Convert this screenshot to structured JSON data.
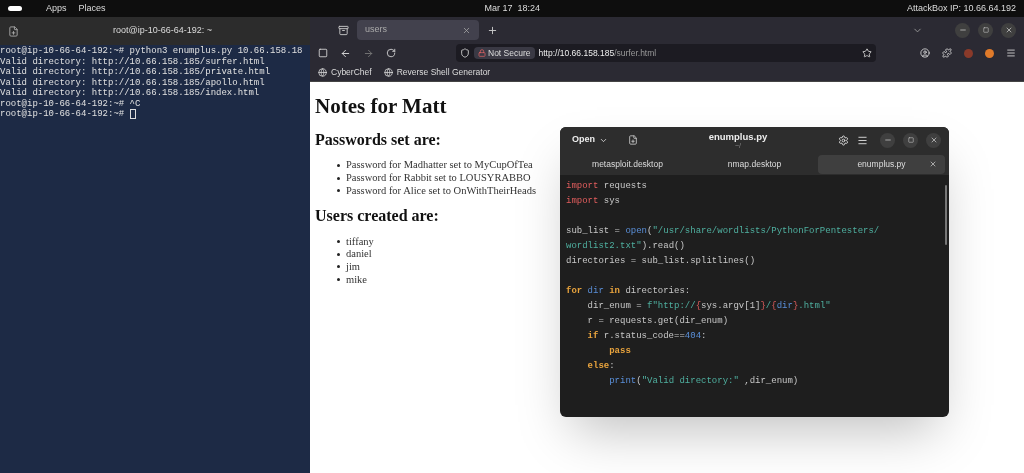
{
  "top_bar": {
    "menus": [
      "Apps",
      "Places"
    ],
    "clock": "Mar 17  18:24",
    "ip_label": "AttackBox IP: 10.66.64.192"
  },
  "terminal": {
    "title": "root@ip-10-66-64-192: ~",
    "lines": [
      "root@ip-10-66-64-192:~# python3 enumplus.py 10.66.158.18",
      "Valid directory: http://10.66.158.185/surfer.html",
      "Valid directory: http://10.66.158.185/private.html",
      "Valid directory: http://10.66.158.185/apollo.html",
      "Valid directory: http://10.66.158.185/index.html",
      "root@ip-10-66-64-192:~# ^C",
      "root@ip-10-66-64-192:~# "
    ],
    "cursor": true
  },
  "browser": {
    "tabs": [
      {
        "label": "users",
        "selected": true
      }
    ],
    "security": "Not Secure",
    "url_host": "http://10.66.158.185",
    "url_path": "/surfer.html",
    "bookmarks": [
      "CyberChef",
      "Reverse Shell Generator"
    ],
    "page": {
      "title": "Notes for Matt",
      "sections": [
        {
          "heading": "Passwords set are:",
          "items": [
            "Password for Madhatter set to MyCupOfTea",
            "Password for Rabbit set to LOUSYRABBO",
            "Password for Alice set to OnWithTheirHeads"
          ]
        },
        {
          "heading": "Users created are:",
          "items": [
            "tiffany",
            "daniel",
            "jim",
            "mike"
          ]
        }
      ]
    }
  },
  "editor": {
    "open_button": "Open",
    "title": "enumplus.py",
    "subtitle": "~/",
    "tabs": [
      {
        "label": "metasploit.desktop",
        "selected": false
      },
      {
        "label": "nmap.desktop",
        "selected": false
      },
      {
        "label": "enumplus.py",
        "selected": true
      }
    ],
    "lines": [
      {
        "kind": "code",
        "tokens": [
          {
            "kind": "keyword",
            "text": "import"
          },
          {
            "kind": "plain",
            "text": " requests"
          }
        ]
      },
      {
        "kind": "code",
        "tokens": [
          {
            "kind": "keyword",
            "text": "import"
          },
          {
            "kind": "plain",
            "text": " sys"
          }
        ]
      },
      {
        "kind": "blank"
      },
      {
        "kind": "code",
        "tokens": [
          {
            "kind": "plain",
            "text": "sub_list = "
          },
          {
            "kind": "builtin",
            "text": "open"
          },
          {
            "kind": "plain",
            "text": "("
          },
          {
            "kind": "string",
            "text": "\"/usr/share/wordlists/PythonForPentesters/"
          }
        ]
      },
      {
        "kind": "code",
        "tokens": [
          {
            "kind": "string",
            "text": "wordlist2.txt\""
          },
          {
            "kind": "plain",
            "text": ").read()"
          }
        ]
      },
      {
        "kind": "code",
        "tokens": [
          {
            "kind": "plain",
            "text": "directories = sub_list.splitlines()"
          }
        ]
      },
      {
        "kind": "blank"
      },
      {
        "kind": "code",
        "tokens": [
          {
            "kind": "control",
            "text": "for"
          },
          {
            "kind": "builtin",
            "text": " dir"
          },
          {
            "kind": "control",
            "text": " in"
          },
          {
            "kind": "plain",
            "text": " directories:"
          }
        ]
      },
      {
        "kind": "code",
        "tokens": [
          {
            "kind": "plain",
            "text": "    dir_enum = "
          },
          {
            "kind": "string",
            "text": "f\"http://"
          },
          {
            "kind": "keyword",
            "text": "{"
          },
          {
            "kind": "plain",
            "text": "sys.argv[1]"
          },
          {
            "kind": "keyword",
            "text": "}"
          },
          {
            "kind": "string",
            "text": "/"
          },
          {
            "kind": "keyword",
            "text": "{"
          },
          {
            "kind": "builtin",
            "text": "dir"
          },
          {
            "kind": "keyword",
            "text": "}"
          },
          {
            "kind": "string",
            "text": ".html\""
          }
        ]
      },
      {
        "kind": "code",
        "tokens": [
          {
            "kind": "plain",
            "text": "    r = requests.get(dir_enum)"
          }
        ]
      },
      {
        "kind": "code",
        "tokens": [
          {
            "kind": "control",
            "text": "    if"
          },
          {
            "kind": "plain",
            "text": " r.status_code=="
          },
          {
            "kind": "number",
            "text": "404"
          },
          {
            "kind": "plain",
            "text": ":"
          }
        ]
      },
      {
        "kind": "code",
        "tokens": [
          {
            "kind": "control",
            "text": "        pass"
          }
        ]
      },
      {
        "kind": "code",
        "tokens": [
          {
            "kind": "control",
            "text": "    else"
          },
          {
            "kind": "plain",
            "text": ":"
          }
        ]
      },
      {
        "kind": "code",
        "tokens": [
          {
            "kind": "builtin",
            "text": "        print"
          },
          {
            "kind": "plain",
            "text": "("
          },
          {
            "kind": "string",
            "text": "\"Valid directory:\""
          },
          {
            "kind": "plain",
            "text": " ,dir_enum)"
          }
        ]
      }
    ]
  }
}
